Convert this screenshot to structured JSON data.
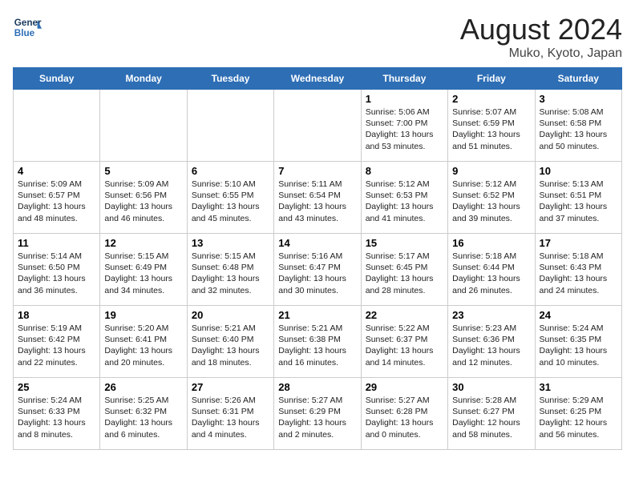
{
  "header": {
    "logo_line1": "General",
    "logo_line2": "Blue",
    "month_year": "August 2024",
    "location": "Muko, Kyoto, Japan"
  },
  "day_headers": [
    "Sunday",
    "Monday",
    "Tuesday",
    "Wednesday",
    "Thursday",
    "Friday",
    "Saturday"
  ],
  "weeks": [
    [
      {
        "day": "",
        "content": ""
      },
      {
        "day": "",
        "content": ""
      },
      {
        "day": "",
        "content": ""
      },
      {
        "day": "",
        "content": ""
      },
      {
        "day": "1",
        "content": "Sunrise: 5:06 AM\nSunset: 7:00 PM\nDaylight: 13 hours\nand 53 minutes."
      },
      {
        "day": "2",
        "content": "Sunrise: 5:07 AM\nSunset: 6:59 PM\nDaylight: 13 hours\nand 51 minutes."
      },
      {
        "day": "3",
        "content": "Sunrise: 5:08 AM\nSunset: 6:58 PM\nDaylight: 13 hours\nand 50 minutes."
      }
    ],
    [
      {
        "day": "4",
        "content": "Sunrise: 5:09 AM\nSunset: 6:57 PM\nDaylight: 13 hours\nand 48 minutes."
      },
      {
        "day": "5",
        "content": "Sunrise: 5:09 AM\nSunset: 6:56 PM\nDaylight: 13 hours\nand 46 minutes."
      },
      {
        "day": "6",
        "content": "Sunrise: 5:10 AM\nSunset: 6:55 PM\nDaylight: 13 hours\nand 45 minutes."
      },
      {
        "day": "7",
        "content": "Sunrise: 5:11 AM\nSunset: 6:54 PM\nDaylight: 13 hours\nand 43 minutes."
      },
      {
        "day": "8",
        "content": "Sunrise: 5:12 AM\nSunset: 6:53 PM\nDaylight: 13 hours\nand 41 minutes."
      },
      {
        "day": "9",
        "content": "Sunrise: 5:12 AM\nSunset: 6:52 PM\nDaylight: 13 hours\nand 39 minutes."
      },
      {
        "day": "10",
        "content": "Sunrise: 5:13 AM\nSunset: 6:51 PM\nDaylight: 13 hours\nand 37 minutes."
      }
    ],
    [
      {
        "day": "11",
        "content": "Sunrise: 5:14 AM\nSunset: 6:50 PM\nDaylight: 13 hours\nand 36 minutes."
      },
      {
        "day": "12",
        "content": "Sunrise: 5:15 AM\nSunset: 6:49 PM\nDaylight: 13 hours\nand 34 minutes."
      },
      {
        "day": "13",
        "content": "Sunrise: 5:15 AM\nSunset: 6:48 PM\nDaylight: 13 hours\nand 32 minutes."
      },
      {
        "day": "14",
        "content": "Sunrise: 5:16 AM\nSunset: 6:47 PM\nDaylight: 13 hours\nand 30 minutes."
      },
      {
        "day": "15",
        "content": "Sunrise: 5:17 AM\nSunset: 6:45 PM\nDaylight: 13 hours\nand 28 minutes."
      },
      {
        "day": "16",
        "content": "Sunrise: 5:18 AM\nSunset: 6:44 PM\nDaylight: 13 hours\nand 26 minutes."
      },
      {
        "day": "17",
        "content": "Sunrise: 5:18 AM\nSunset: 6:43 PM\nDaylight: 13 hours\nand 24 minutes."
      }
    ],
    [
      {
        "day": "18",
        "content": "Sunrise: 5:19 AM\nSunset: 6:42 PM\nDaylight: 13 hours\nand 22 minutes."
      },
      {
        "day": "19",
        "content": "Sunrise: 5:20 AM\nSunset: 6:41 PM\nDaylight: 13 hours\nand 20 minutes."
      },
      {
        "day": "20",
        "content": "Sunrise: 5:21 AM\nSunset: 6:40 PM\nDaylight: 13 hours\nand 18 minutes."
      },
      {
        "day": "21",
        "content": "Sunrise: 5:21 AM\nSunset: 6:38 PM\nDaylight: 13 hours\nand 16 minutes."
      },
      {
        "day": "22",
        "content": "Sunrise: 5:22 AM\nSunset: 6:37 PM\nDaylight: 13 hours\nand 14 minutes."
      },
      {
        "day": "23",
        "content": "Sunrise: 5:23 AM\nSunset: 6:36 PM\nDaylight: 13 hours\nand 12 minutes."
      },
      {
        "day": "24",
        "content": "Sunrise: 5:24 AM\nSunset: 6:35 PM\nDaylight: 13 hours\nand 10 minutes."
      }
    ],
    [
      {
        "day": "25",
        "content": "Sunrise: 5:24 AM\nSunset: 6:33 PM\nDaylight: 13 hours\nand 8 minutes."
      },
      {
        "day": "26",
        "content": "Sunrise: 5:25 AM\nSunset: 6:32 PM\nDaylight: 13 hours\nand 6 minutes."
      },
      {
        "day": "27",
        "content": "Sunrise: 5:26 AM\nSunset: 6:31 PM\nDaylight: 13 hours\nand 4 minutes."
      },
      {
        "day": "28",
        "content": "Sunrise: 5:27 AM\nSunset: 6:29 PM\nDaylight: 13 hours\nand 2 minutes."
      },
      {
        "day": "29",
        "content": "Sunrise: 5:27 AM\nSunset: 6:28 PM\nDaylight: 13 hours\nand 0 minutes."
      },
      {
        "day": "30",
        "content": "Sunrise: 5:28 AM\nSunset: 6:27 PM\nDaylight: 12 hours\nand 58 minutes."
      },
      {
        "day": "31",
        "content": "Sunrise: 5:29 AM\nSunset: 6:25 PM\nDaylight: 12 hours\nand 56 minutes."
      }
    ]
  ]
}
